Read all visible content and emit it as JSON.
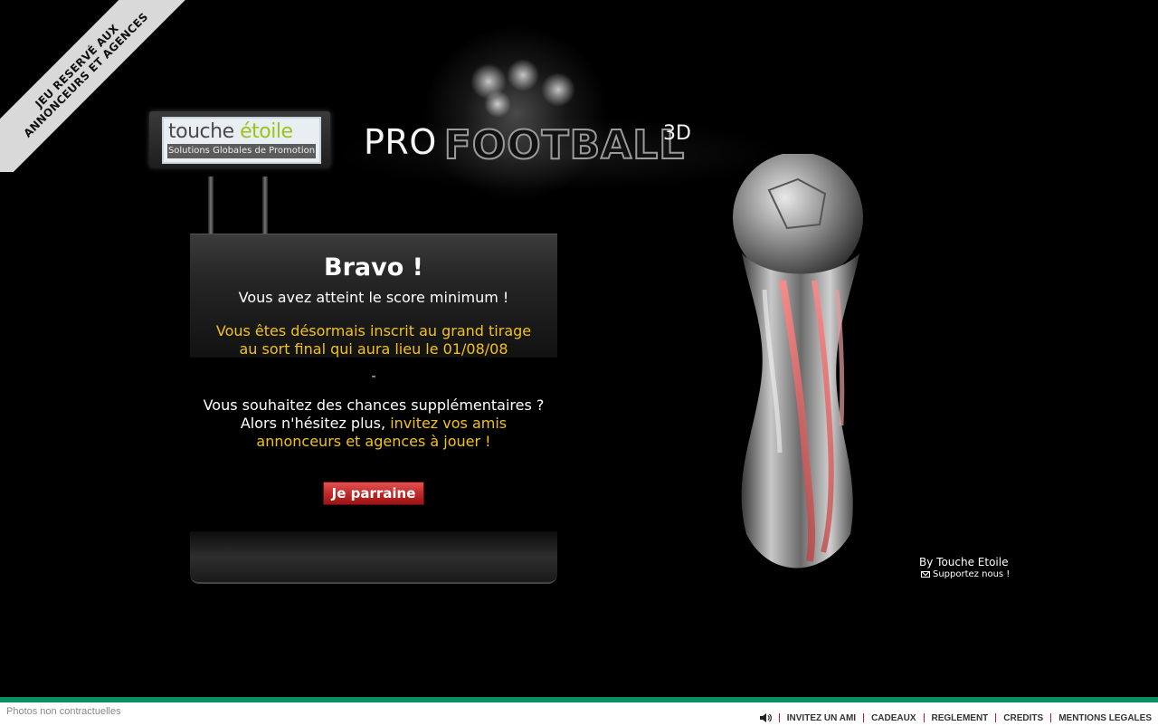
{
  "ribbon": {
    "line1": "JEU RESERVÉ AUX",
    "line2": "ANNONCEURS ET AGENCES"
  },
  "sign": {
    "brand_part1": "touche ",
    "brand_part2": "étoile",
    "tagline": "Solutions Globales de Promotion"
  },
  "title": {
    "pro": "PRO",
    "football": "FOOTBALL",
    "suffix": "3D"
  },
  "panel": {
    "heading": "Bravo !",
    "score_text": "Vous avez atteint le score minimum !",
    "draw_line1": "Vous êtes désormais inscrit au grand tirage",
    "draw_line2": "au sort final qui aura lieu le 01/08/08",
    "separator": "-",
    "extra_line1": "Vous souhaitez des chances supplémentaires ?",
    "extra_line2_plain": "Alors n'hésitez plus, ",
    "extra_line2_highlight": "invitez vos amis",
    "extra_line3": "annonceurs et agences à jouer !",
    "button_label": "Je parraine"
  },
  "credits": {
    "by": "By Touche Etoile",
    "support": "Supportez nous !"
  },
  "footer": {
    "note": "Photos non contractuelles",
    "links": [
      "INVITEZ UN AMI",
      "CADEAUX",
      "REGLEMENT",
      "CREDITS",
      "MENTIONS LEGALES"
    ]
  },
  "colors": {
    "accent_yellow": "#f2c21b",
    "footer_bar": "#0c8f63",
    "button_red": "#c12a2a",
    "logo_green": "#9cc21c"
  }
}
